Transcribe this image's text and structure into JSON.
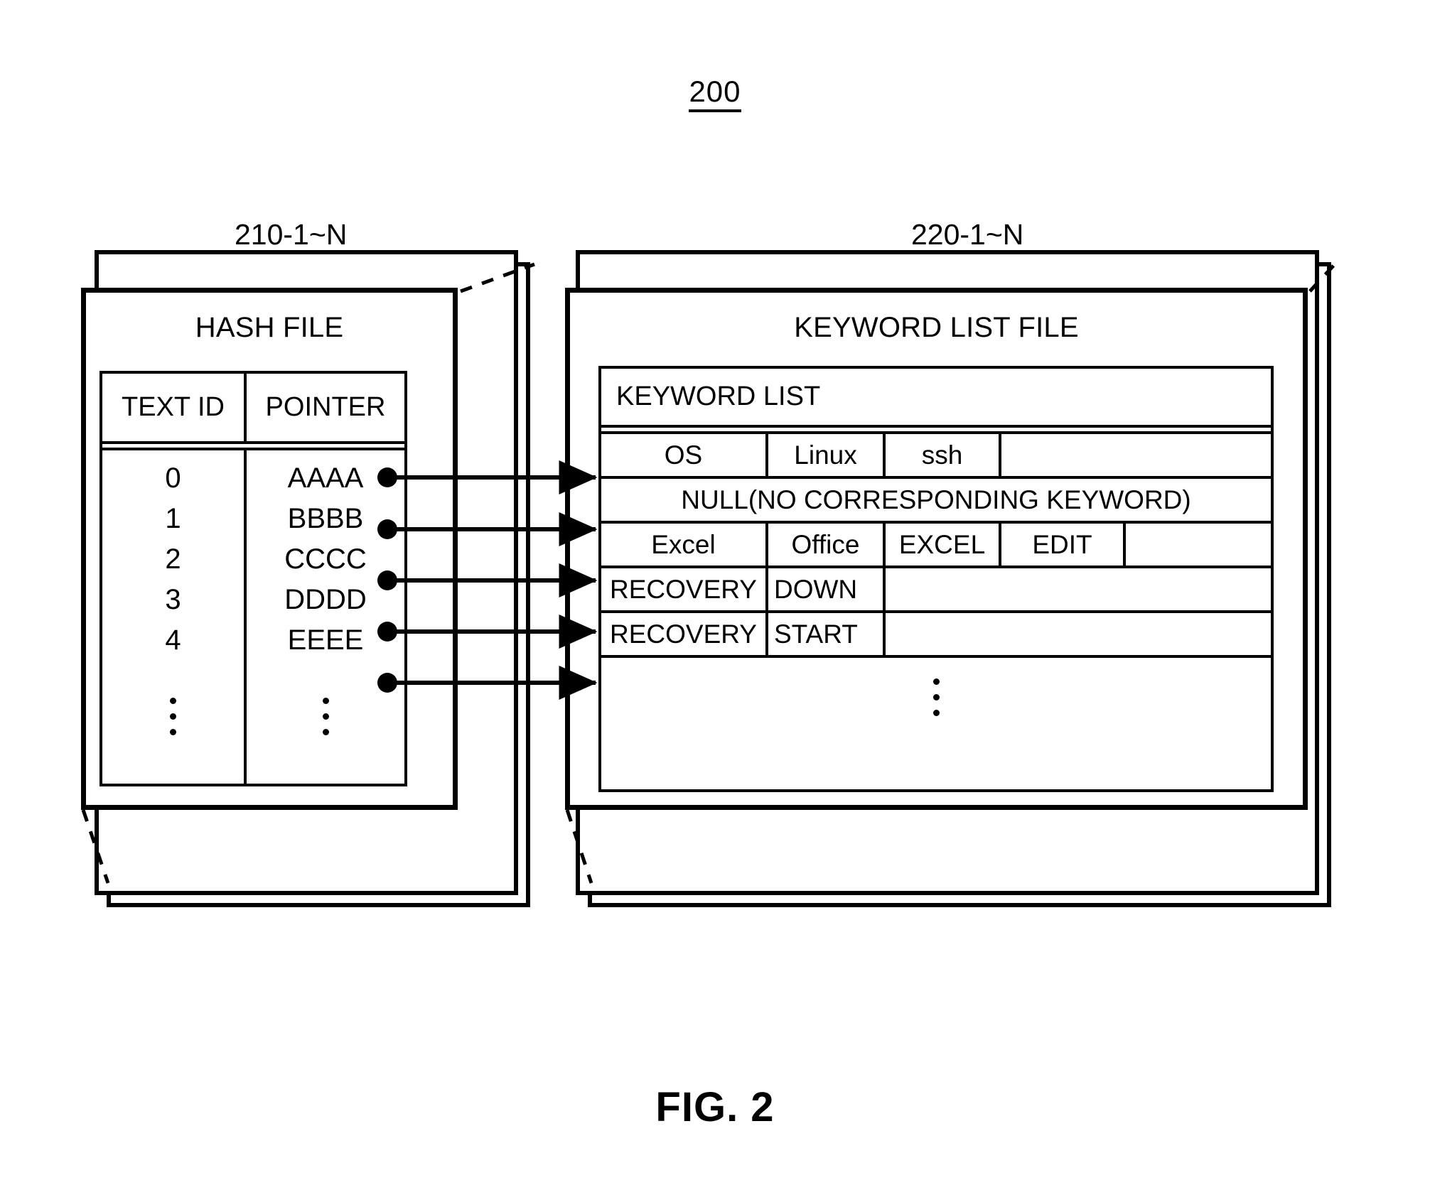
{
  "figure": {
    "reference_number": "200",
    "caption": "FIG. 2"
  },
  "callouts": {
    "hash_file_ref": "210-1~N",
    "keyword_file_ref": "220-1~N"
  },
  "hash_file": {
    "title": "HASH FILE",
    "columns": [
      "TEXT ID",
      "POINTER"
    ],
    "rows": [
      {
        "text_id": "0",
        "pointer": "AAAA"
      },
      {
        "text_id": "1",
        "pointer": "BBBB"
      },
      {
        "text_id": "2",
        "pointer": "CCCC"
      },
      {
        "text_id": "3",
        "pointer": "DDDD"
      },
      {
        "text_id": "4",
        "pointer": "EEEE"
      }
    ],
    "continuation": "vertical-ellipsis"
  },
  "keyword_list_file": {
    "title": "KEYWORD LIST FILE",
    "section_header": "KEYWORD LIST",
    "entries": [
      {
        "type": "keywords",
        "cells": [
          "OS",
          "Linux",
          "ssh"
        ],
        "trailing_empty_cells": 1
      },
      {
        "type": "null",
        "text": "NULL(NO CORRESPONDING KEYWORD)"
      },
      {
        "type": "keywords",
        "cells": [
          "Excel",
          "Office",
          "EXCEL",
          "EDIT"
        ],
        "trailing_empty_cells": 1
      },
      {
        "type": "keywords",
        "cells": [
          "RECOVERY",
          "DOWN"
        ],
        "trailing_empty_cells": 1
      },
      {
        "type": "keywords",
        "cells": [
          "RECOVERY",
          "START"
        ],
        "trailing_empty_cells": 1
      }
    ],
    "continuation": "vertical-ellipsis"
  },
  "colors": {
    "ink": "#000000",
    "paper": "#ffffff"
  }
}
